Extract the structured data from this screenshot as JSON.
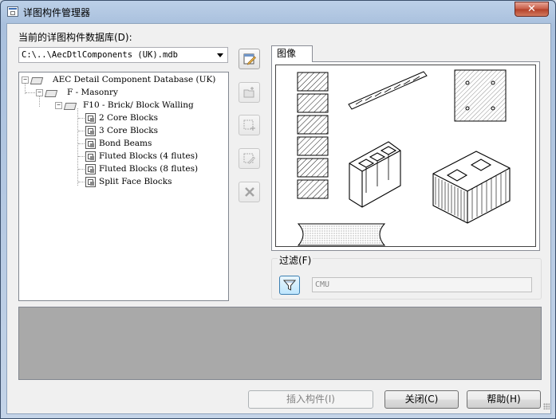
{
  "window": {
    "title": "详图构件管理器",
    "close_label": "✕"
  },
  "database": {
    "label": "当前的详图构件数据库(D):",
    "value": "C:\\..\\AecDtlComponents (UK).mdb"
  },
  "tree": {
    "root": "AEC Detail Component Database (UK)",
    "level1": "F - Masonry",
    "level2": "F10 - Brick/ Block Walling",
    "leaves": [
      "2 Core Blocks",
      "3 Core Blocks",
      "Bond Beams",
      "Fluted Blocks (4 flutes)",
      "Fluted Blocks (8 flutes)",
      "Split Face Blocks"
    ]
  },
  "toolbar": {
    "icons": [
      "edit-database-icon",
      "new-folder-icon",
      "new-component-icon",
      "edit-component-icon",
      "delete-icon"
    ]
  },
  "preview": {
    "tab_label": "图像"
  },
  "filter": {
    "label": "过滤(F)",
    "value": "CMU"
  },
  "buttons": {
    "insert": "插入构件(I)",
    "close": "关闭(C)",
    "help": "帮助(H)"
  },
  "colors": {
    "accent": "#3c7fb1",
    "close_button": "#c75a44",
    "description_bg": "#a9a9a9"
  }
}
